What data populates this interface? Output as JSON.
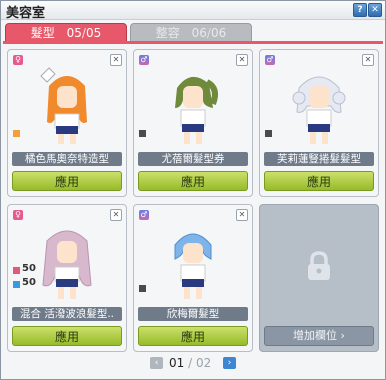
{
  "window": {
    "title": "美容室",
    "help_icon": "question-icon",
    "close_icon": "close-icon"
  },
  "tabs": [
    {
      "label": "髮型",
      "current": "05",
      "total": "05",
      "active": true
    },
    {
      "label": "整容",
      "current": "06",
      "total": "06",
      "active": false
    }
  ],
  "slots": [
    {
      "gender": "♀",
      "name": "橘色馬奧奈特造型",
      "apply": "應用",
      "swatches": [
        {
          "color": "#f2a03c"
        }
      ]
    },
    {
      "gender": "♂",
      "name": "尤蓓爾髮型券",
      "apply": "應用",
      "swatches": [
        {
          "color": "#4b4b4b"
        }
      ]
    },
    {
      "gender": "♂",
      "name": "芙莉蓮豎捲髮髮型",
      "apply": "應用",
      "swatches": [
        {
          "color": "#4b4b4b"
        }
      ]
    },
    {
      "gender": "♀",
      "name": "混合 活潑波浪髮型..",
      "apply": "應用",
      "mix": [
        "50",
        "50"
      ],
      "swatches": [
        {
          "color": "#e05a7a"
        },
        {
          "color": "#3a9ae0"
        }
      ]
    },
    {
      "gender": "♂",
      "name": "欣梅爾髮型",
      "apply": "應用",
      "swatches": [
        {
          "color": "#4b4b4b"
        }
      ]
    }
  ],
  "empty_slot": {
    "add_label": "增加欄位 ›",
    "icon": "lock-icon"
  },
  "pager": {
    "current": "01",
    "separator": "/",
    "total": "02"
  }
}
